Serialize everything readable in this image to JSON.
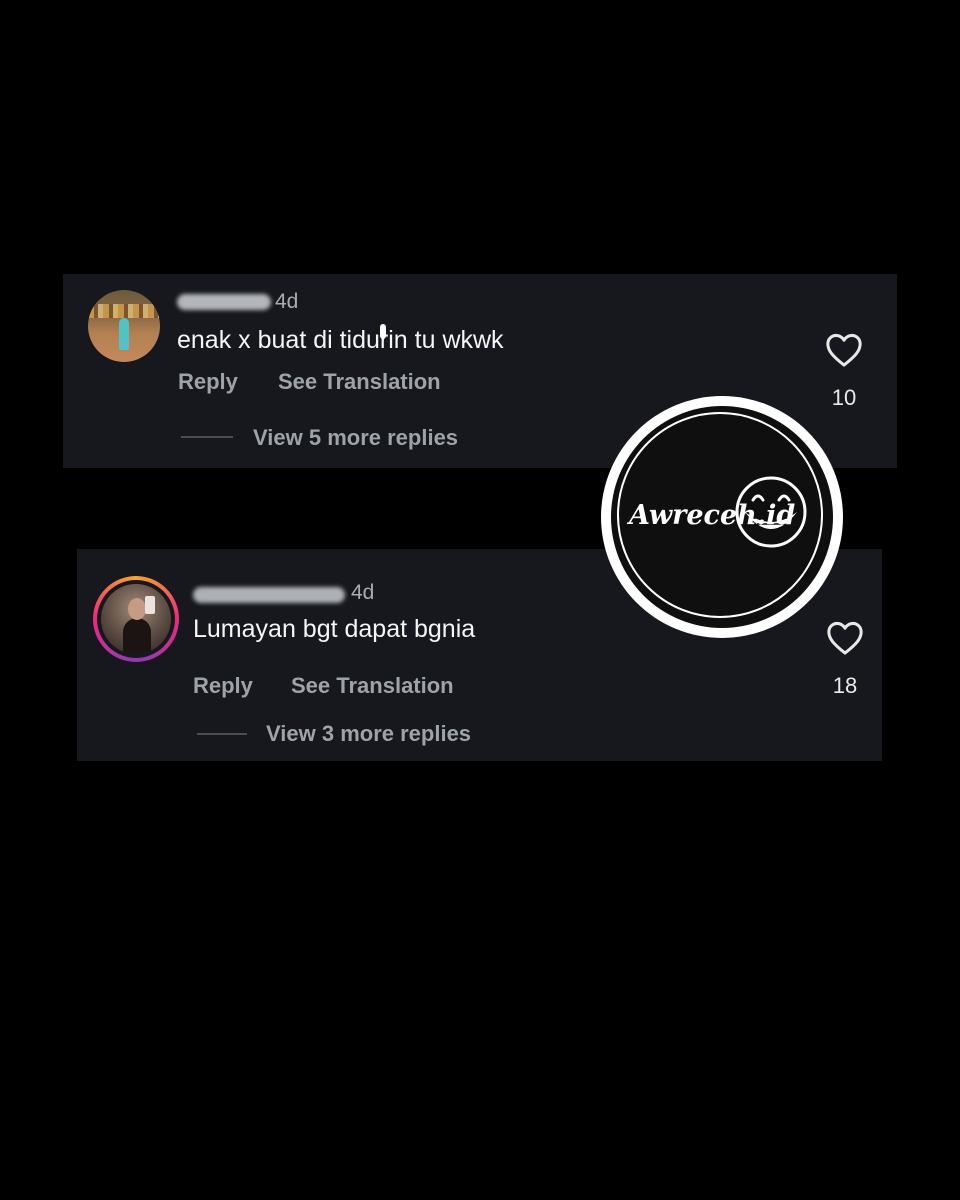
{
  "comments": [
    {
      "username": "ikalordd",
      "time": "4d",
      "text": "enak x buat di tidurin tu wkwk",
      "reply_label": "Reply",
      "translate_label": "See Translation",
      "view_replies_label": "View 5 more replies",
      "likes": "10",
      "avatar": "avatar-photo-tennis-court",
      "has_story_ring": false
    },
    {
      "username": "__nesyazahra",
      "time": "4d",
      "text": "Lumayan bgt dapat bgnia",
      "reply_label": "Reply",
      "translate_label": "See Translation",
      "view_replies_label": "View 3 more replies",
      "likes": "18",
      "avatar": "avatar-photo-selfie",
      "has_story_ring": true
    }
  ],
  "watermark": {
    "text": "Awreceh.id",
    "icon": "grinning-face-mask-icon"
  },
  "colors": {
    "background": "#000000",
    "card": "#16181d",
    "text_primary": "#f5f5f5",
    "text_secondary": "#9ea2a9",
    "story_ring": [
      "#f9a825",
      "#ee2a7b",
      "#8a3ab9"
    ]
  }
}
